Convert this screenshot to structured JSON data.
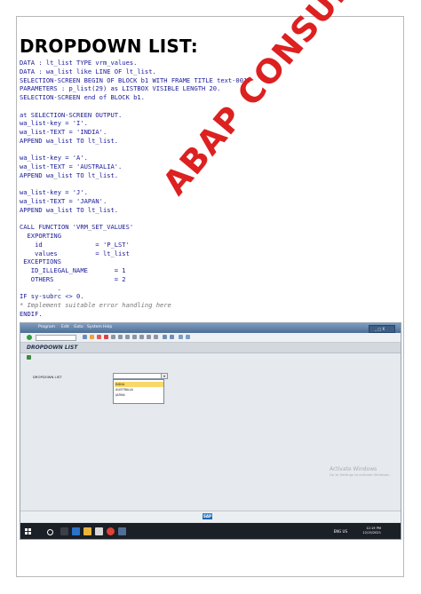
{
  "heading": "DROPDOWN LIST:",
  "code_lines": [
    [
      "DATA : lt_list TYPE vrm_values."
    ],
    [
      "DATA : wa_list like LINE OF lt_list."
    ],
    [
      "SELECTION-SCREEN BEGIN OF BLOCK b1 WITH FRAME TITLE text-001."
    ],
    [
      "PARAMETERS : p_list(29) as LISTBOX VISIBLE LENGTH 20."
    ],
    [
      "SELECTION-SCREEN end of BLOCK b1."
    ],
    [
      ""
    ],
    [
      "at SELECTION-SCREEN OUTPUT."
    ],
    [
      "wa_list-key = 'I'."
    ],
    [
      "wa_list-TEXT = 'INDIA'."
    ],
    [
      "APPEND wa_list TO lt_list."
    ],
    [
      ""
    ],
    [
      "wa_list-key = 'A'."
    ],
    [
      "wa_list-TEXT = 'AUSTRALIA'."
    ],
    [
      "APPEND wa_list TO lt_list."
    ],
    [
      ""
    ],
    [
      "wa_list-key = 'J'."
    ],
    [
      "wa_list-TEXT = 'JAPAN'."
    ],
    [
      "APPEND wa_list TO lt_list."
    ],
    [
      ""
    ],
    [
      "CALL FUNCTION 'VRM_SET_VALUES'"
    ],
    [
      "  EXPORTING"
    ],
    [
      "    id              = 'P_LST'"
    ],
    [
      "    values          = lt_list"
    ],
    [
      " EXCEPTIONS"
    ],
    [
      "   ID_ILLEGAL_NAME       = 1"
    ],
    [
      "   OTHERS                = 2"
    ],
    [
      "          ."
    ],
    [
      "IF sy-subrc <> 0."
    ],
    [
      "* Implement suitable error handling here"
    ],
    [
      "ENDIF."
    ]
  ],
  "watermark": "ABAP CONSULTANT",
  "sap": {
    "menu": [
      "Program",
      "Edit",
      "Goto",
      "System",
      "Help"
    ],
    "window_controls": "_ □ X",
    "screen_title": "DROPDOWN LIST",
    "field_label": "DROPDOWN LIST",
    "field_arrow": "▾",
    "dropdown_options": [
      "INDIA",
      "AUSTRALIA",
      "JAPAN"
    ],
    "selected_option_index": 0,
    "activation_title": "Activate Windows",
    "activation_sub": "Go to Settings to activate Windows.",
    "status_logo": "SAP",
    "taskbar_time": "12:19 PM",
    "taskbar_date": "12/15/2021",
    "taskbar_lang": "ENG US"
  },
  "colors": {
    "heading": "#000000",
    "code_keyword": "#1a1aa8",
    "code_string": "#2c7a2c",
    "code_number": "#2a8a8a",
    "watermark": "#dd2020",
    "selected_option": "#f7d86a"
  }
}
